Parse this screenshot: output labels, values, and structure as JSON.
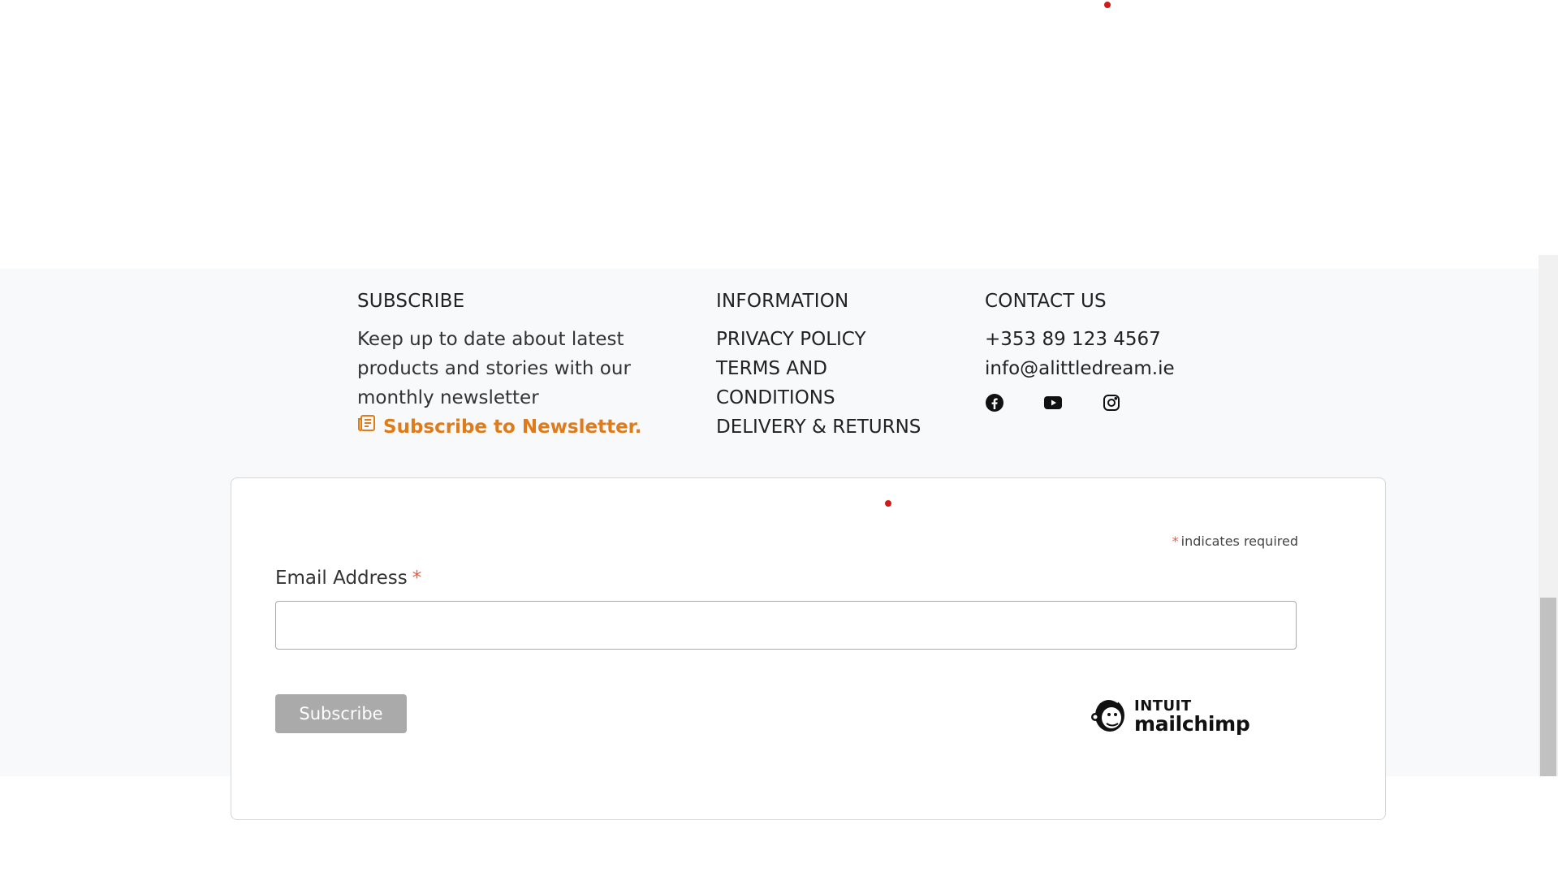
{
  "colors": {
    "accent_orange": "#e07b1a",
    "required_red": "#e85c41",
    "dot_red": "#d11a1a",
    "footer_bg": "#f8f9fb",
    "button_gray": "#aaaaaa"
  },
  "subscribe": {
    "heading": "SUBSCRIBE",
    "description": "Keep up to date about latest products and stories with our monthly newsletter",
    "newsletter_icon": "newspaper-icon",
    "newsletter_link": "Subscribe to Newsletter."
  },
  "information": {
    "heading": "INFORMATION",
    "links": [
      "PRIVACY POLICY",
      "TERMS AND CONDITIONS",
      "DELIVERY & RETURNS"
    ]
  },
  "contact": {
    "heading": "CONTACT US",
    "phone": "+353 89 123 4567",
    "email": "info@alittledream.ie",
    "social": [
      "facebook-icon",
      "youtube-icon",
      "instagram-icon"
    ]
  },
  "form": {
    "required_marker": "*",
    "required_note": "indicates required",
    "email_label": "Email Address",
    "email_value": "",
    "subscribe_label": "Subscribe",
    "brand_top": "INTUIT",
    "brand_bottom": "mailchimp"
  }
}
